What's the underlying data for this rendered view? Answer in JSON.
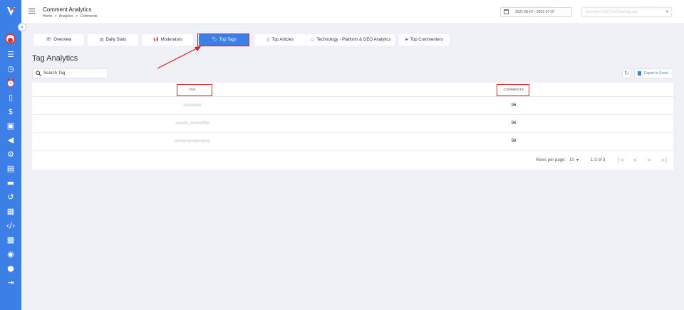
{
  "topbar": {
    "title": "Comment Analytics",
    "breadcrumb": [
      "Home",
      ">",
      "Analytics",
      ">",
      "Comments"
    ],
    "date_range": "2021-06-07 - 2021-07-07",
    "site_select": "Anywhere/Tell/The/Tinkering.app"
  },
  "sidebar": {
    "icons": [
      "list-icon",
      "clock-icon",
      "alarm-icon",
      "book-icon",
      "dollar-icon",
      "ticket-icon",
      "megaphone-icon",
      "gear-icon",
      "chart-icon",
      "card-icon",
      "history-icon",
      "columns-icon",
      "code-icon",
      "building-icon",
      "support-icon",
      "chat-icon",
      "logout-icon"
    ],
    "collapse_glyph": "‹"
  },
  "tabs": [
    {
      "label": "Overview",
      "icon": "eye-icon",
      "glyph": "👁"
    },
    {
      "label": "Daily Stats",
      "icon": "chart-icon",
      "glyph": "▥"
    },
    {
      "label": "Moderators",
      "icon": "megaphone-icon",
      "glyph": "📢"
    },
    {
      "label": "Top Tags",
      "icon": "tags-icon",
      "glyph": "🏷",
      "active": true
    },
    {
      "label": "Top Articles",
      "icon": "file-icon",
      "glyph": "▯"
    },
    {
      "label": "Technology - Platform & GEO Analytics",
      "icon": "laptop-icon",
      "glyph": "▭"
    },
    {
      "label": "Top Commenters",
      "icon": "comment-icon",
      "glyph": "▰"
    }
  ],
  "section_title": "Tag Analytics",
  "search": {
    "placeholder": "Search Tag"
  },
  "export_label": "Export to Excel",
  "table": {
    "headers": {
      "tag": "TAG",
      "comments": "COMMENTS"
    },
    "rows": [
      {
        "tag": "scheduled",
        "comments": "96"
      },
      {
        "tag": "asaubu_tesdeddlfal",
        "comments": "96"
      },
      {
        "tag": "gangangangangang",
        "comments": "96"
      }
    ]
  },
  "pagination": {
    "rows_per_page_label": "Rows per page:",
    "rows_per_page": "10",
    "range": "1-3 of 3",
    "first_glyph": "|<",
    "prev_glyph": "<",
    "next_glyph": ">",
    "last_glyph": ">|"
  },
  "colors": {
    "accent": "#3c7fe6",
    "highlight": "#d8202a",
    "background": "#eff1f6"
  }
}
